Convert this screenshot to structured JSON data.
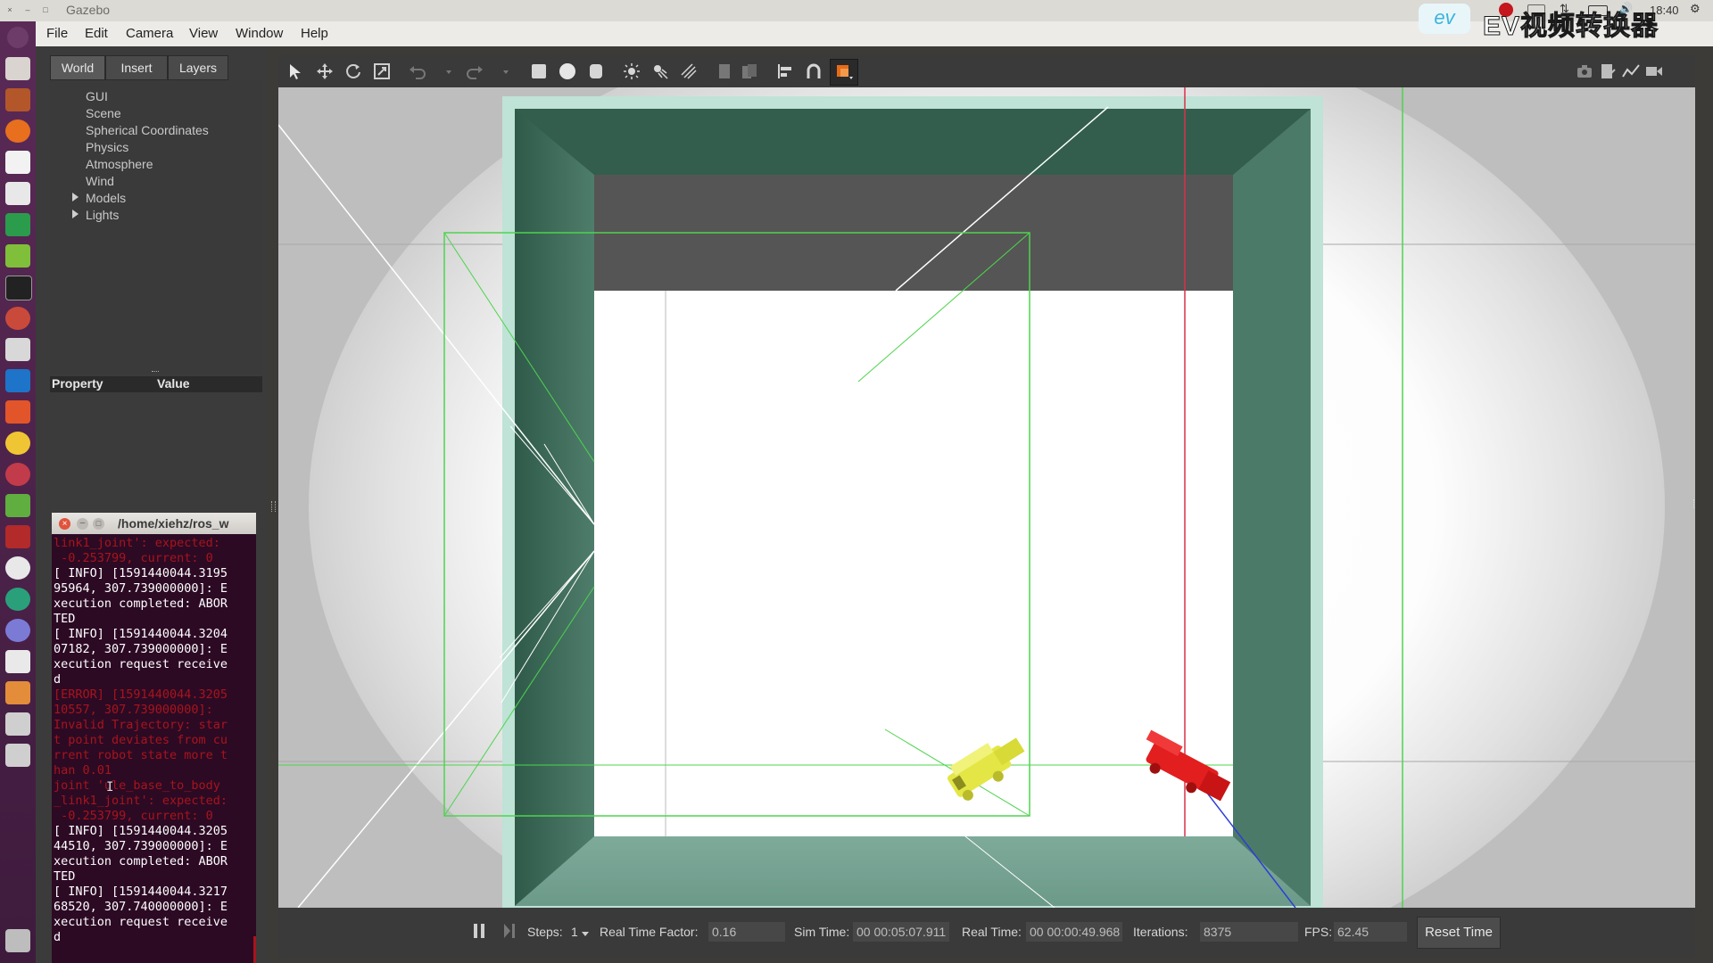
{
  "window": {
    "title": "Gazebo"
  },
  "tray": {
    "time": "18:40"
  },
  "menubar": {
    "items": [
      "File",
      "Edit",
      "Camera",
      "View",
      "Window",
      "Help"
    ]
  },
  "watermark": {
    "logo_text": "ev",
    "label": "EV视频转换器"
  },
  "left_panel": {
    "tabs": [
      "World",
      "Insert",
      "Layers"
    ],
    "tree": [
      "GUI",
      "Scene",
      "Spherical Coordinates",
      "Physics",
      "Atmosphere",
      "Wind",
      "Models",
      "Lights"
    ],
    "property_header": {
      "property": "Property",
      "value": "Value"
    }
  },
  "terminal": {
    "title": "/home/xiehz/ros_w",
    "lines": [
      {
        "text": "link1_joint': expected:",
        "type": "err"
      },
      {
        "text": " -0.253799, current: 0",
        "type": "err"
      },
      {
        "text": "[ INFO] [1591440044.3195",
        "type": "info"
      },
      {
        "text": "95964, 307.739000000]: E",
        "type": "info"
      },
      {
        "text": "xecution completed: ABOR",
        "type": "info"
      },
      {
        "text": "TED",
        "type": "info"
      },
      {
        "text": "[ INFO] [1591440044.3204",
        "type": "info"
      },
      {
        "text": "07182, 307.739000000]: E",
        "type": "info"
      },
      {
        "text": "xecution request receive",
        "type": "info"
      },
      {
        "text": "d",
        "type": "info"
      },
      {
        "text": "[ERROR] [1591440044.3205",
        "type": "err"
      },
      {
        "text": "10557, 307.739000000]:",
        "type": "err"
      },
      {
        "text": "Invalid Trajectory: star",
        "type": "err"
      },
      {
        "text": "t point deviates from cu",
        "type": "err"
      },
      {
        "text": "rrent robot state more t",
        "type": "err"
      },
      {
        "text": "han 0.01",
        "type": "err"
      },
      {
        "text": "joint 'ule_base_to_body",
        "type": "err"
      },
      {
        "text": "_link1_joint': expected:",
        "type": "err"
      },
      {
        "text": " -0.253799, current: 0",
        "type": "err"
      },
      {
        "text": "[ INFO] [1591440044.3205",
        "type": "info"
      },
      {
        "text": "44510, 307.739000000]: E",
        "type": "info"
      },
      {
        "text": "xecution completed: ABOR",
        "type": "info"
      },
      {
        "text": "TED",
        "type": "info"
      },
      {
        "text": "[ INFO] [1591440044.3217",
        "type": "info"
      },
      {
        "text": "68520, 307.740000000]: E",
        "type": "info"
      },
      {
        "text": "xecution request receive",
        "type": "info"
      },
      {
        "text": "d",
        "type": "info"
      }
    ]
  },
  "toolbar": {
    "icons": [
      "select-arrow-icon",
      "translate-icon",
      "rotate-icon",
      "scale-icon",
      "undo-icon",
      "undo-dropdown-icon",
      "redo-icon",
      "redo-dropdown-icon",
      "box-shape-icon",
      "sphere-shape-icon",
      "cylinder-shape-icon",
      "point-light-icon",
      "spot-light-icon",
      "directional-light-icon",
      "copy-icon",
      "paste-icon",
      "align-icon",
      "snap-icon",
      "view-angle-icon"
    ],
    "right_icons": [
      "screenshot-icon",
      "log-icon",
      "plot-icon",
      "record-video-icon"
    ]
  },
  "bottom_bar": {
    "steps_label": "Steps:",
    "steps_value": "1",
    "rtf_label": "Real Time Factor:",
    "rtf_value": "0.16",
    "sim_time_label": "Sim Time:",
    "sim_time_value": "00 00:05:07.911",
    "real_time_label": "Real Time:",
    "real_time_value": "00 00:00:49.968",
    "iterations_label": "Iterations:",
    "iterations_value": "8375",
    "fps_label": "FPS:",
    "fps_value": "62.45",
    "reset_label": "Reset Time"
  },
  "colors": {
    "launcher": "#4a2147",
    "terminal_bg": "#2c0a24",
    "error_text": "#a8141c",
    "robot_yellow": "#e6e83a",
    "robot_red": "#e02020",
    "wall_green": "#3f6b5a"
  }
}
